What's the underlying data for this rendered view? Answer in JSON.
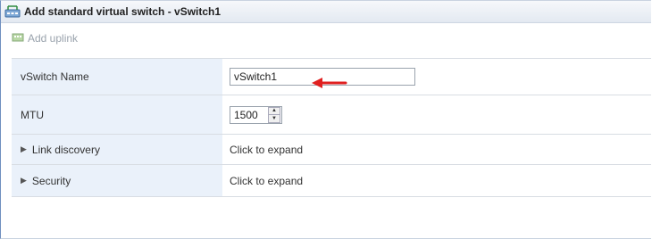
{
  "dialog": {
    "title": "Add standard virtual switch - vSwitch1",
    "title_icon": "virtual-switch-icon"
  },
  "toolbar": {
    "add_uplink_label": "Add uplink",
    "add_uplink_icon": "network-adapter-icon"
  },
  "fields": {
    "vswitch_name": {
      "label": "vSwitch Name",
      "value": "vSwitch1"
    },
    "mtu": {
      "label": "MTU",
      "value": "1500"
    },
    "link_discovery": {
      "label": "Link discovery",
      "value": "Click to expand"
    },
    "security": {
      "label": "Security",
      "value": "Click to expand"
    }
  },
  "annotation": {
    "color": "#e02020"
  },
  "colors": {
    "label_bg": "#eaf1fa",
    "border": "#d8dde3"
  }
}
